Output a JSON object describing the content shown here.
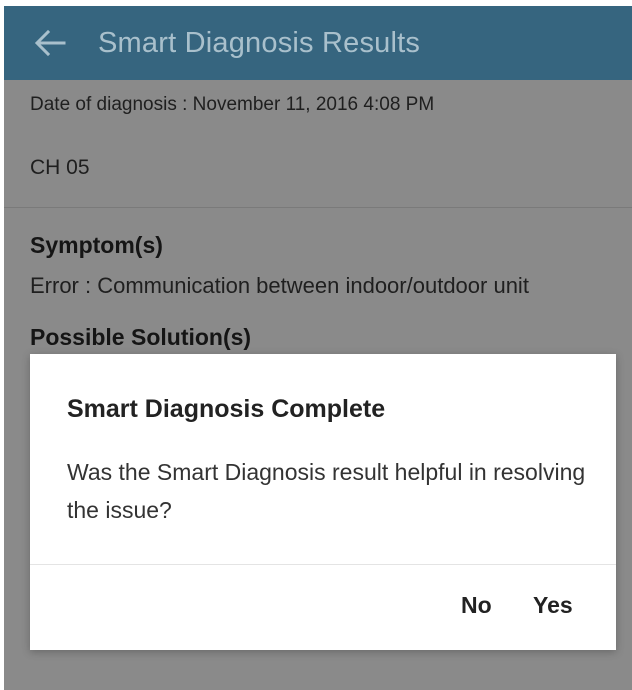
{
  "app_bar": {
    "title": "Smart Diagnosis Results",
    "back_icon": "arrow-left-icon"
  },
  "diagnosis": {
    "date_line": "Date of diagnosis : November 11, 2016 4:08 PM",
    "model": "CH 05",
    "symptom_heading": "Symptom(s)",
    "symptom_text": "Error : Communication between indoor/outdoor unit",
    "solution_heading": "Possible Solution(s)"
  },
  "dialog": {
    "title": "Smart Diagnosis Complete",
    "message": "Was the Smart Diagnosis result helpful in resolving the issue?",
    "no_label": "No",
    "yes_label": "Yes"
  },
  "colors": {
    "app_bar": "#36657f",
    "app_bar_text": "#a9c0cc",
    "scrim_background": "#8a8a8a",
    "dialog_background": "#ffffff"
  }
}
